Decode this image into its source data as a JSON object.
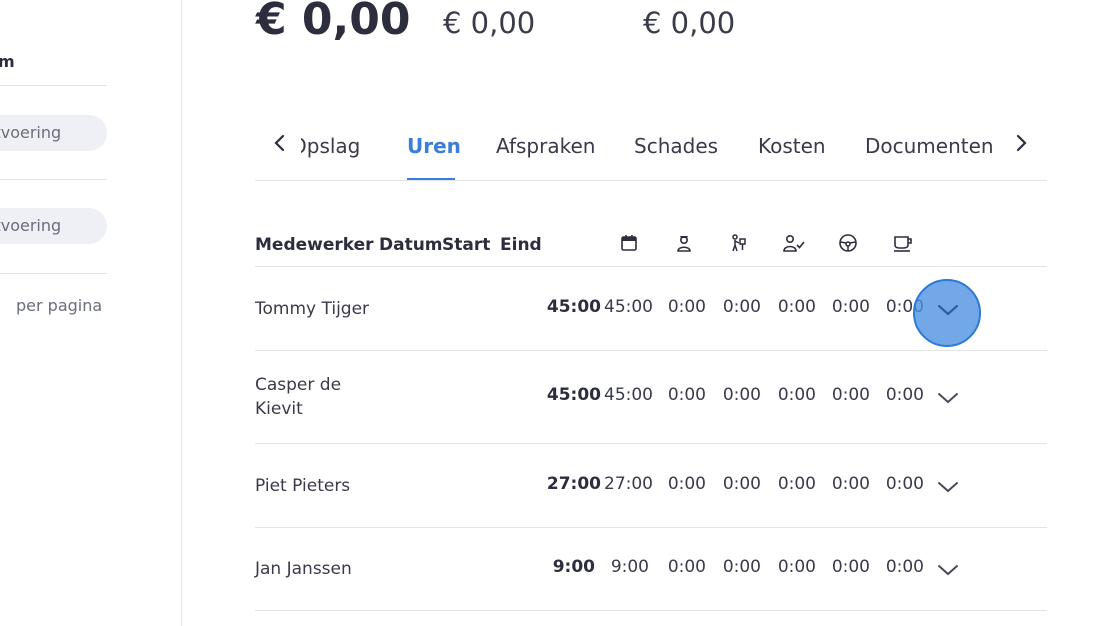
{
  "left_panel": {
    "heading": "m",
    "pill_1": "itvoering",
    "pill_2": "itvoering",
    "per_page_label": "per pagina"
  },
  "amounts": {
    "main": "€ 0,00",
    "secondary_1": "€ 0,00",
    "secondary_2": "€ 0,00"
  },
  "tabs": {
    "items": [
      "Opslag",
      "Uren",
      "Afspraken",
      "Schades",
      "Kosten",
      "Documenten"
    ],
    "active": "Uren"
  },
  "table": {
    "headers": {
      "employee": "Medewerker",
      "date": "Datum",
      "start": "Start",
      "end": "Eind"
    },
    "header_icons": [
      "calendar-icon",
      "person-badge-icon",
      "person-working-icon",
      "person-check-icon",
      "steering-wheel-icon",
      "coffee-cup-icon"
    ],
    "rows": [
      {
        "name": "Tommy Tijger",
        "total": "45:00",
        "values": [
          "45:00",
          "0:00",
          "0:00",
          "0:00",
          "0:00",
          "0:00"
        ]
      },
      {
        "name": "Casper de Kievit",
        "total": "45:00",
        "values": [
          "45:00",
          "0:00",
          "0:00",
          "0:00",
          "0:00",
          "0:00"
        ]
      },
      {
        "name": "Piet Pieters",
        "total": "27:00",
        "values": [
          "27:00",
          "0:00",
          "0:00",
          "0:00",
          "0:00",
          "0:00"
        ]
      },
      {
        "name": "Jan Janssen",
        "total": "9:00",
        "values": [
          "9:00",
          "0:00",
          "0:00",
          "0:00",
          "0:00",
          "0:00"
        ]
      }
    ]
  },
  "colors": {
    "accent": "#3b7dd8",
    "text": "#2d2e3d",
    "divider": "#e3e4e8",
    "highlight": "#4a90e2"
  }
}
